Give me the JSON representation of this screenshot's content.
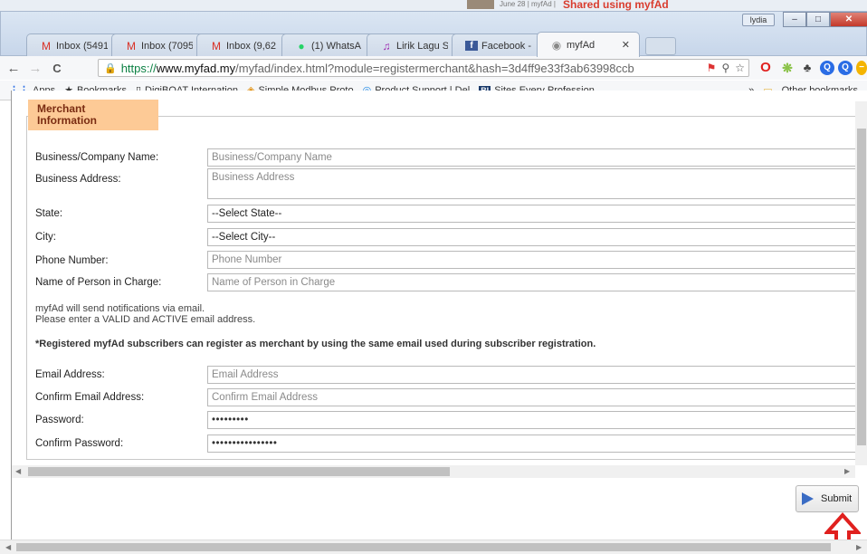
{
  "desktop": {
    "note": "June 28 | myfAd |",
    "shared": "Shared using myfAd"
  },
  "window": {
    "profile": "lydia",
    "buttons": {
      "minimize": "‒",
      "maximize": "□",
      "close": "✕"
    }
  },
  "tabs": [
    {
      "label": "Inbox (5491",
      "icon": "gmail-icon",
      "glyph": "M",
      "color": "#d93025"
    },
    {
      "label": "Inbox (7095",
      "icon": "gmail-icon",
      "glyph": "M",
      "color": "#d93025"
    },
    {
      "label": "Inbox (9,62",
      "icon": "gmail-icon",
      "glyph": "M",
      "color": "#d93025"
    },
    {
      "label": "(1) WhatsA",
      "icon": "whatsapp-icon",
      "glyph": "●",
      "color": "#25d366"
    },
    {
      "label": "Lirik Lagu S",
      "icon": "music-icon",
      "glyph": "♫",
      "color": "#9c27b0"
    },
    {
      "label": "Facebook -",
      "icon": "facebook-icon",
      "glyph": "f",
      "color": "#3b5998"
    },
    {
      "label": "myfAd",
      "icon": "myfad-icon",
      "glyph": "◉",
      "color": "#888888"
    }
  ],
  "toolbar": {
    "back": "←",
    "forward": "→",
    "reload": "C",
    "url_scheme": "https://",
    "url_host": "www.myfad.my",
    "url_rest": "/myfad/index.html?module=registermerchant&hash=3d4ff9e33f3ab63998ccb",
    "omni_icons": [
      "⚑",
      "⚲",
      "☆"
    ]
  },
  "bookmarks": {
    "items": [
      {
        "label": "Apps",
        "icon": "apps-grid-icon",
        "glyph": "⋮⋮"
      },
      {
        "label": "Bookmarks",
        "icon": "star-icon",
        "glyph": "★"
      },
      {
        "label": "DigiBOAT Internation",
        "icon": "page-icon",
        "glyph": "▯"
      },
      {
        "label": "Simple Modbus Proto",
        "icon": "modbus-icon",
        "glyph": "◈"
      },
      {
        "label": "Product Support | Del",
        "icon": "dell-icon",
        "glyph": "◎"
      },
      {
        "label": "Sites Every Profession",
        "icon": "bi-icon",
        "glyph": "BI"
      }
    ],
    "overflow": "»",
    "other": "Other bookmarks"
  },
  "form": {
    "legend": "Merchant\nInformation",
    "business_name_label": "Business/Company Name:",
    "business_name_placeholder": "Business/Company Name",
    "business_address_label": "Business Address:",
    "business_address_placeholder": "Business Address",
    "state_label": "State:",
    "state_value": "--Select State--",
    "city_label": "City:",
    "city_value": "--Select City--",
    "phone_label": "Phone Number:",
    "phone_placeholder": "Phone Number",
    "pic_label": "Name of Person in Charge:",
    "pic_placeholder": "Name of Person in Charge",
    "notice_line1": "myfAd will send notifications via email.",
    "notice_line2": "Please enter a VALID and ACTIVE email address.",
    "bold_notice": "*Registered myfAd subscribers can register as merchant by using the same email used during subscriber registration.",
    "email_label": "Email Address:",
    "email_placeholder": "Email Address",
    "confirm_email_label": "Confirm Email Address:",
    "confirm_email_placeholder": "Confirm Email Address",
    "password_label": "Password:",
    "password_value": "•••••••••",
    "confirm_password_label": "Confirm Password:",
    "confirm_password_value": "••••••••••••••••"
  },
  "submit": {
    "label": "Submit"
  },
  "colors": {
    "legend_bg": "#fdca96",
    "arrow_red": "#e0201e",
    "submit_play": "#3a6cc4"
  }
}
